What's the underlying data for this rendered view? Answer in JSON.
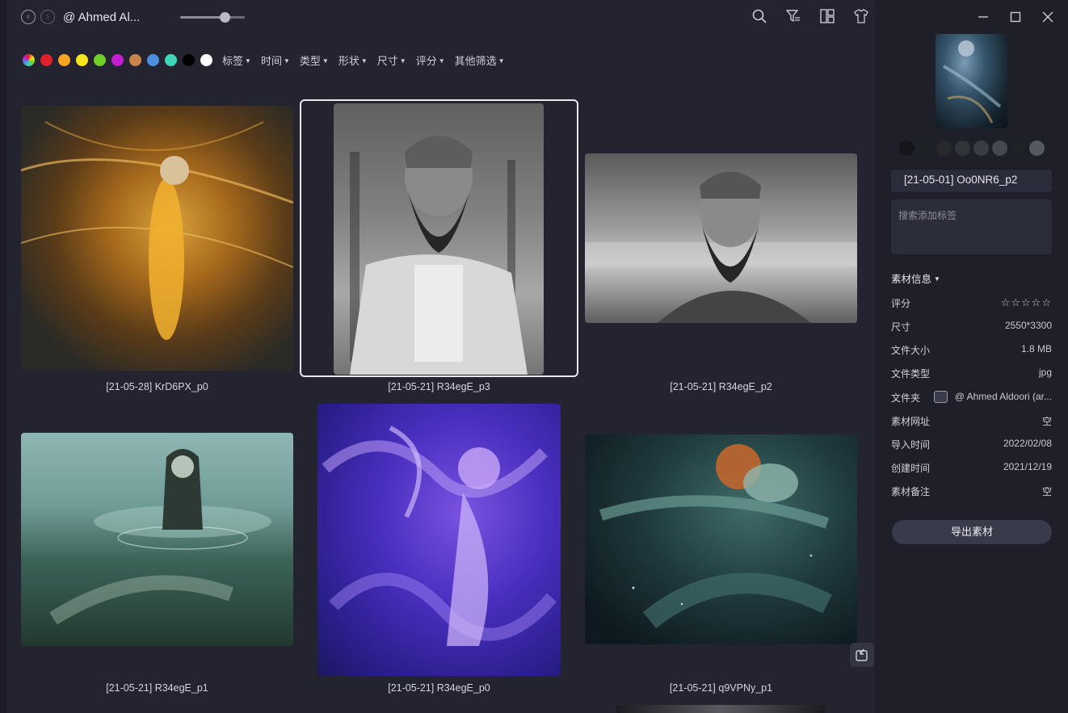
{
  "topbar": {
    "folder_title": "@ Ahmed Al...",
    "zoom_level": 0.69
  },
  "filters": {
    "colors": [
      "#ffffff00",
      "#e0202b",
      "#f6a623",
      "#f7e51e",
      "#6fcf26",
      "#c31fd0",
      "#c8844a",
      "#4a8fe0",
      "#3fd6b9",
      "#000000",
      "#ffffff"
    ],
    "items": [
      "标签",
      "时间",
      "类型",
      "形状",
      "尺寸",
      "评分",
      "其他筛选"
    ]
  },
  "grid": {
    "items": [
      {
        "caption": "[21-05-28] KrD6PX_p0",
        "icon": "mermaid-golden-painting"
      },
      {
        "caption": "[21-05-21] R34egE_p3",
        "icon": "bearded-man-sketch-portrait",
        "selected": true
      },
      {
        "caption": "[21-05-21] R34egE_p2",
        "icon": "bearded-man-sketch-landscape"
      },
      {
        "caption": "[21-05-21] R34egE_p1",
        "icon": "mermaid-in-water-painting"
      },
      {
        "caption": "[21-05-21] R34egE_p0",
        "icon": "octopus-woman-purple-painting"
      },
      {
        "caption": "[21-05-21] q9VPNy_p1",
        "icon": "mermaid-underwater-painting"
      }
    ]
  },
  "panel": {
    "palette": [
      "#15161b",
      "#1e2125",
      "#262a2d",
      "#2e3438",
      "#383d44",
      "#444a52",
      "#1d2226",
      "#555961"
    ],
    "name": "[21-05-01] Oo0NR6_p2",
    "tag_placeholder": "搜索添加标签",
    "info_header": "素材信息",
    "rows": {
      "rating_label": "评分",
      "rating": 0,
      "size_label": "尺寸",
      "size": "2550*3300",
      "filesize_label": "文件大小",
      "filesize": "1.8 MB",
      "filetype_label": "文件类型",
      "filetype": "jpg",
      "folder_label": "文件夹",
      "folder": "@ Ahmed Aldoori (ar...",
      "url_label": "素材网址",
      "url": "空",
      "import_label": "导入时间",
      "import": "2022/02/08",
      "created_label": "创建时间",
      "created": "2021/12/19",
      "note_label": "素材备注",
      "note": "空"
    },
    "export_label": "导出素材"
  }
}
